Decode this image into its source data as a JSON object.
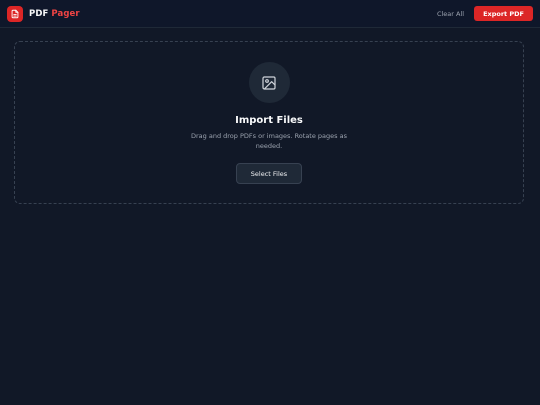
{
  "header": {
    "brand_part1": "PDF",
    "brand_part2": "Pager",
    "clear_label": "Clear All",
    "export_label": "Export PDF"
  },
  "dropzone": {
    "title": "Import Files",
    "description": "Drag and drop PDFs or images. Rotate pages as needed.",
    "button_label": "Select Files"
  },
  "icons": {
    "logo": "pdf-document-icon",
    "dropzone": "image-icon"
  },
  "colors": {
    "background": "#111827",
    "accent": "#dc2626",
    "surface": "#1f2937",
    "border": "#374151",
    "muted_text": "#9ca3af"
  }
}
